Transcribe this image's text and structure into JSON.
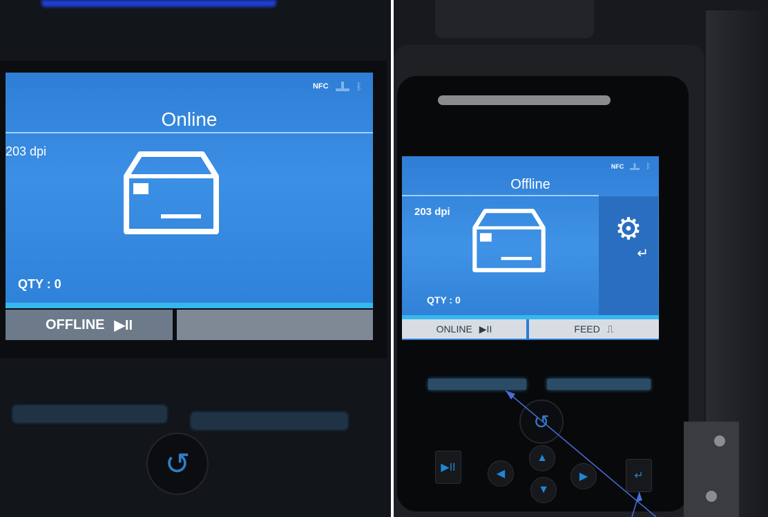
{
  "left_display": {
    "status_icons": {
      "nfc": "NFC",
      "network_icon": "network-icon",
      "bluetooth_icon": "bluetooth-icon"
    },
    "title": "Online",
    "resolution": "203 dpi",
    "quantity": "QTY : 0",
    "softkey_left": {
      "label": "OFFLINE",
      "icon": "▶II"
    },
    "softkey_right": {
      "label": ""
    }
  },
  "right_display": {
    "status_icons": {
      "nfc": "NFC",
      "network_icon": "network-icon",
      "bluetooth_icon": "bluetooth-icon"
    },
    "title": "Offline",
    "resolution": "203 dpi",
    "quantity": "QTY : 0",
    "settings_icon": "gear-icon",
    "softkey_left": {
      "label": "ONLINE",
      "icon": "▶II"
    },
    "softkey_right": {
      "label": "FEED",
      "icon": "⎍"
    }
  },
  "colors": {
    "screen_blue": "#3b8fe4",
    "softbar_cyan": "#36b8ee",
    "annotation": "#4a6fd8"
  }
}
